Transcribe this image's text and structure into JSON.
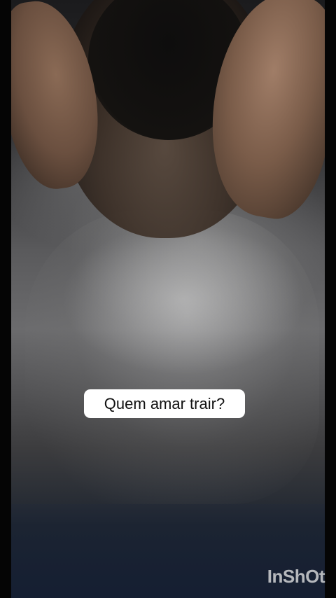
{
  "caption": {
    "text": "Quem amar trair?"
  },
  "watermark": {
    "text": "InShOt"
  },
  "colors": {
    "caption_background": "#ffffff",
    "caption_text": "#111111",
    "background": "#000000"
  }
}
